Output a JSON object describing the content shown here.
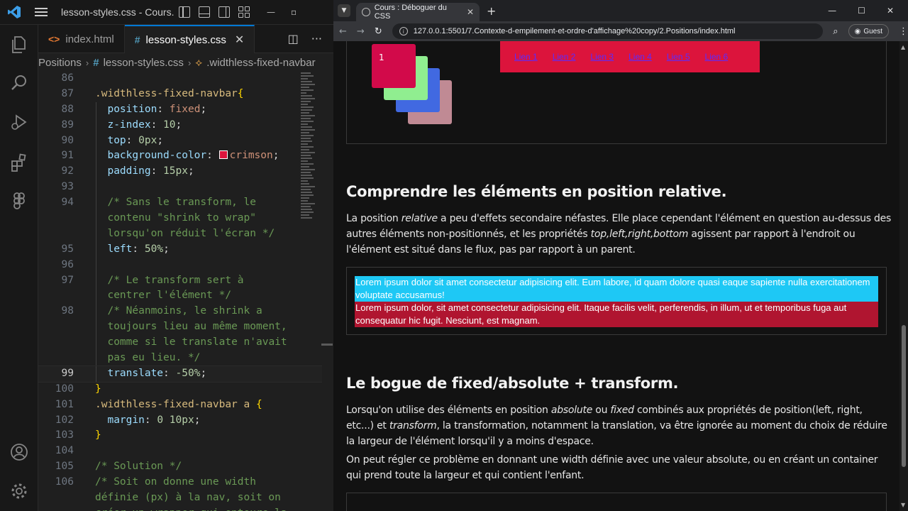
{
  "vscode": {
    "title": "lesson-styles.css - Cours...",
    "tabs": [
      {
        "label": "index.html",
        "icon": "<>",
        "active": false
      },
      {
        "label": "lesson-styles.css",
        "icon": "#",
        "active": true
      }
    ],
    "breadcrumb": {
      "folder": "Positions",
      "file": "lesson-styles.css",
      "selector": ".widthless-fixed-navbar"
    },
    "lines": [
      {
        "n": "86",
        "html": ""
      },
      {
        "n": "87",
        "html": "<span class=\"sel\">.widthless-fixed-navbar</span><span class=\"brace\">{</span>"
      },
      {
        "n": "88",
        "html": "  <span class=\"prop\">position</span>: <span class=\"val\">fixed</span>;"
      },
      {
        "n": "89",
        "html": "  <span class=\"prop\">z-index</span>: <span class=\"num\">10</span>;"
      },
      {
        "n": "90",
        "html": "  <span class=\"prop\">top</span>: <span class=\"num\">0px</span>;"
      },
      {
        "n": "91",
        "html": "  <span class=\"prop\">background-color</span>: <span class=\"swatch\"></span><span class=\"val\">crimson</span>;"
      },
      {
        "n": "92",
        "html": "  <span class=\"prop\">padding</span>: <span class=\"num\">15px</span>;"
      },
      {
        "n": "93",
        "html": ""
      },
      {
        "n": "94",
        "html": "  <span class=\"cmt\">/* Sans le transform, le</span>"
      },
      {
        "n": "",
        "html": "  <span class=\"cmt\">contenu \"shrink to wrap\"</span>"
      },
      {
        "n": "",
        "html": "  <span class=\"cmt\">lorsqu'on réduit l'écran */</span>"
      },
      {
        "n": "95",
        "html": "  <span class=\"prop\">left</span>: <span class=\"num\">50%</span>;"
      },
      {
        "n": "96",
        "html": ""
      },
      {
        "n": "97",
        "html": "  <span class=\"cmt\">/* Le transform sert à</span>"
      },
      {
        "n": "",
        "html": "  <span class=\"cmt\">centrer l'élément */</span>"
      },
      {
        "n": "98",
        "html": "  <span class=\"cmt\">/* Néanmoins, le shrink a</span>"
      },
      {
        "n": "",
        "html": "  <span class=\"cmt\">toujours lieu au même moment,</span>"
      },
      {
        "n": "",
        "html": "  <span class=\"cmt\">comme si le translate n'avait</span>"
      },
      {
        "n": "",
        "html": "  <span class=\"cmt\">pas eu lieu. */</span>"
      },
      {
        "n": "99",
        "html": "  <span class=\"prop\">translate</span>: <span class=\"num\">-50%</span>;",
        "current": true
      },
      {
        "n": "100",
        "html": "<span class=\"brace\">}</span>"
      },
      {
        "n": "101",
        "html": "<span class=\"sel\">.widthless-fixed-navbar a</span> <span class=\"brace\">{</span>"
      },
      {
        "n": "102",
        "html": "  <span class=\"prop\">margin</span>: <span class=\"num\">0 10px</span>;"
      },
      {
        "n": "103",
        "html": "<span class=\"brace\">}</span>"
      },
      {
        "n": "104",
        "html": ""
      },
      {
        "n": "105",
        "html": "<span class=\"cmt\">/* Solution */</span>"
      },
      {
        "n": "106",
        "html": "<span class=\"cmt\">/* Soit on donne une width</span>"
      },
      {
        "n": "",
        "html": "<span class=\"cmt\">définie (px) à la nav, soit on</span>"
      },
      {
        "n": "",
        "html": "<span class=\"cmt\">créer un wrapper qui entoure la</span>"
      }
    ]
  },
  "browser": {
    "tab_title": "Cours : Déboguer du CSS",
    "url": "127.0.0.1:5501/7.Contexte-d-empilement-et-ordre-d'affichage%20copy/2.Positions/index.html",
    "profile": "Guest",
    "demo": {
      "square_label": "1",
      "nav_links": [
        "Lien 1",
        "Lien 2",
        "Lien 3",
        "Lien 4",
        "Lien 5",
        "Lien 6"
      ]
    },
    "section1": {
      "title": "Comprendre les éléments en position relative.",
      "para_html": "La position <i>relative</i> a peu d'effets secondaire néfastes. Elle place cependant l'élément en question au-dessus des autres éléments non-positionnés, et les propriétés <i>top,left,right,bottom</i> agissent par rapport à l'endroit ou l'élément est situé dans le flux, pas par rapport à un parent.",
      "cyan_text": "Lorem ipsum dolor sit amet consectetur adipisicing elit. Eum labore, id quam dolore quasi eaque sapiente nulla exercitationem voluptate accusamus!",
      "red_text": "Lorem ipsum dolor, sit amet consectetur adipisicing elit. Itaque facilis velit, perferendis, in illum, ut et temporibus fuga aut consequatur hic fugit. Nesciunt, est magnam."
    },
    "section2": {
      "title": "Le bogue de fixed/absolute + transform.",
      "para1_html": "Lorsqu'on utilise des éléments en position <i>absolute</i> ou <i>fixed</i> combinés aux propriétés de position(left, right, etc...) et <i>transform</i>, la transformation, notamment la translation, va être ignorée au moment du choix de réduire la largeur de l'élément lorsqu'il y a moins d'espace.",
      "para2": "On peut régler ce problème en donnant une width définie avec une valeur absolute, ou en créant un container qui prend toute la largeur et qui contient l'enfant."
    }
  }
}
